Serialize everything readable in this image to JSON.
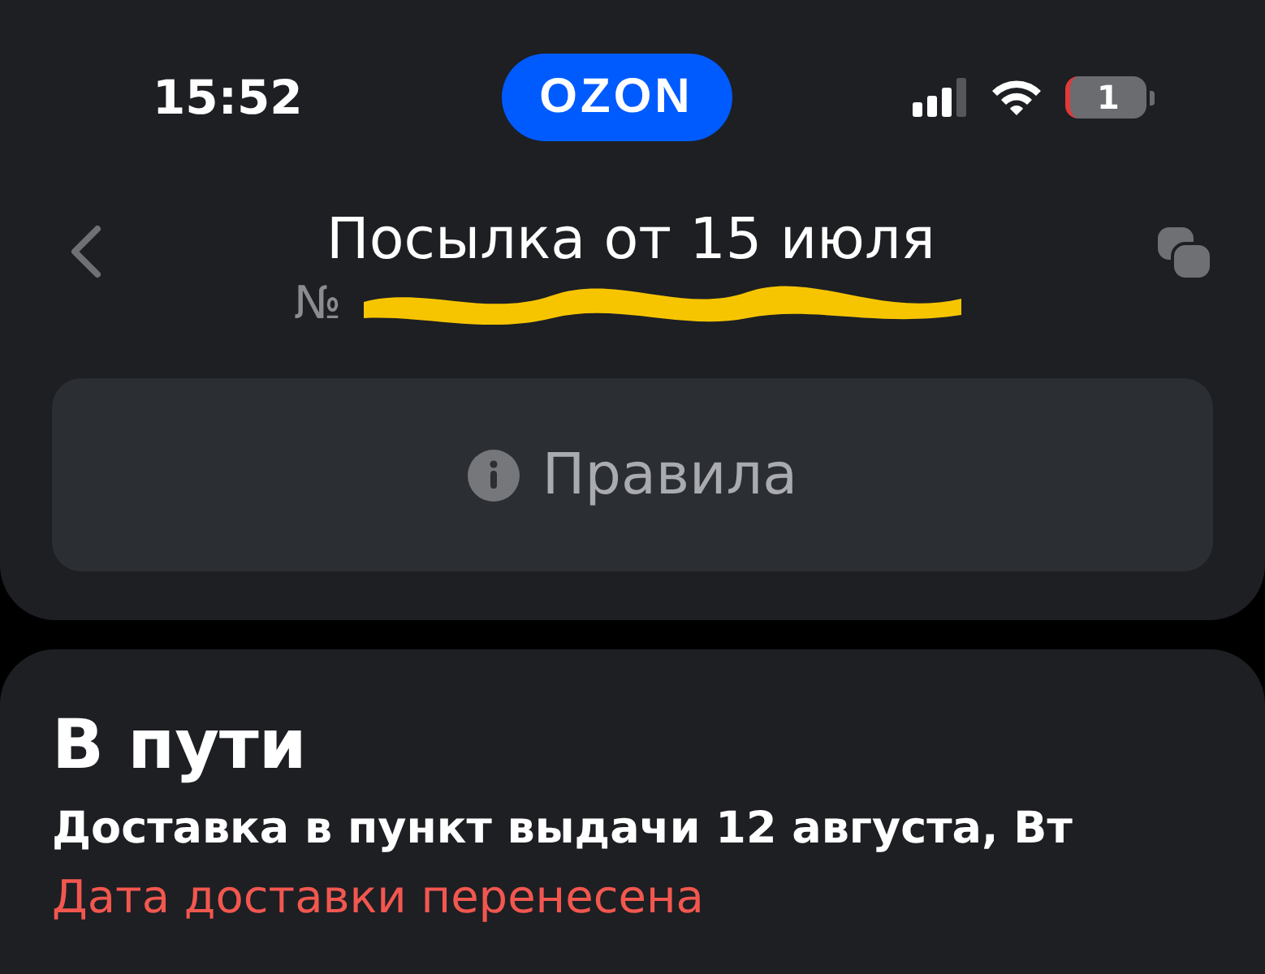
{
  "status_bar": {
    "time": "15:52",
    "logo": "OZON",
    "battery": "1"
  },
  "header": {
    "title": "Посылка от 15 июля",
    "number_prefix": "№"
  },
  "rules_button": {
    "label": "Правила"
  },
  "status_card": {
    "title": "В пути",
    "delivery": "Доставка в пункт выдачи 12 августа, Вт",
    "notice": "Дата доставки перенесена"
  }
}
